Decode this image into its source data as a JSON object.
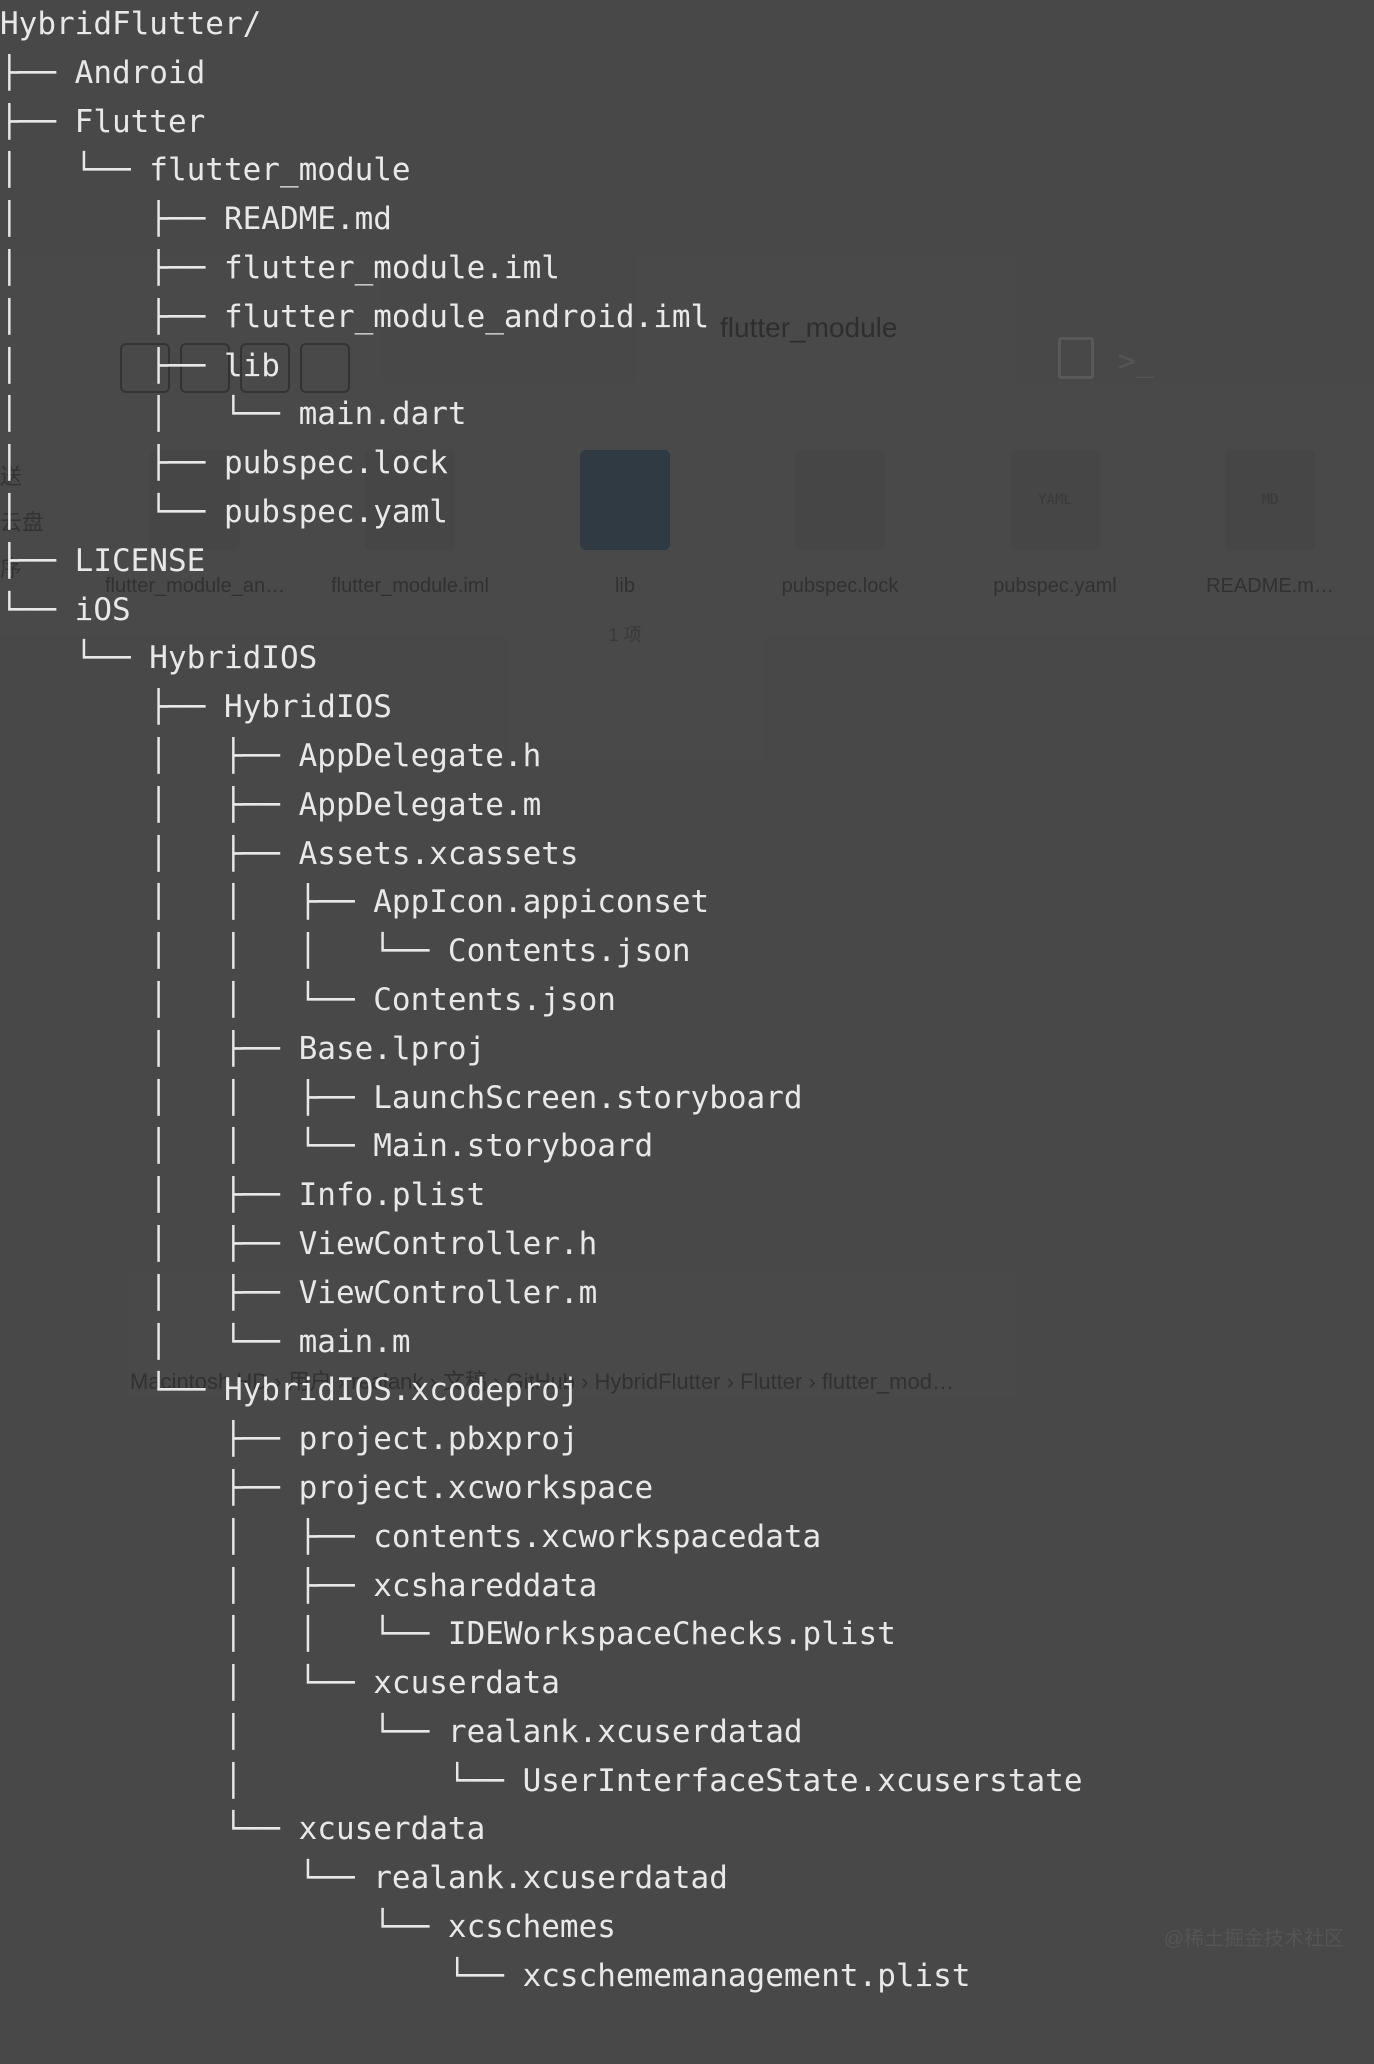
{
  "tree_lines": [
    "HybridFlutter/",
    "├── Android",
    "├── Flutter",
    "│   └── flutter_module",
    "│       ├── README.md",
    "│       ├── flutter_module.iml",
    "│       ├── flutter_module_android.iml",
    "│       ├── lib",
    "│       │   └── main.dart",
    "│       ├── pubspec.lock",
    "│       └── pubspec.yaml",
    "├── LICENSE",
    "└── iOS",
    "    └── HybridIOS",
    "        ├── HybridIOS",
    "        │   ├── AppDelegate.h",
    "        │   ├── AppDelegate.m",
    "        │   ├── Assets.xcassets",
    "        │   │   ├── AppIcon.appiconset",
    "        │   │   │   └── Contents.json",
    "        │   │   └── Contents.json",
    "        │   ├── Base.lproj",
    "        │   │   ├── LaunchScreen.storyboard",
    "        │   │   └── Main.storyboard",
    "        │   ├── Info.plist",
    "        │   ├── ViewController.h",
    "        │   ├── ViewController.m",
    "        │   └── main.m",
    "        └── HybridIOS.xcodeproj",
    "            ├── project.pbxproj",
    "            ├── project.xcworkspace",
    "            │   ├── contents.xcworkspacedata",
    "            │   ├── xcshareddata",
    "            │   │   └── IDEWorkspaceChecks.plist",
    "            │   └── xcuserdata",
    "            │       └── realank.xcuserdatad",
    "            │           └── UserInterfaceState.xcuserstate",
    "            └── xcuserdata",
    "                └── realank.xcuserdatad",
    "                    └── xcschemes",
    "                        └── xcschememanagement.plist"
  ],
  "backdrop": {
    "tab_title": "flutter_module",
    "sidebar_items": [
      "送",
      "云盘",
      "序"
    ],
    "files": [
      {
        "name": "flutter_module_an…",
        "type": "file",
        "badge": ""
      },
      {
        "name": "flutter_module.iml",
        "type": "file",
        "badge": ""
      },
      {
        "name": "lib",
        "type": "folder",
        "badge": "1 项"
      },
      {
        "name": "pubspec.lock",
        "type": "file",
        "badge": ""
      },
      {
        "name": "pubspec.yaml",
        "type": "file",
        "badge": "YAML"
      },
      {
        "name": "README.m…",
        "type": "file",
        "badge": "MD"
      }
    ],
    "breadcrumb": [
      "Macintosh HD",
      "用户",
      "realank",
      "文稿",
      "GitHub",
      "HybridFlutter",
      "Flutter",
      "flutter_mod…"
    ]
  },
  "watermark": "@稀土掘金技术社区"
}
